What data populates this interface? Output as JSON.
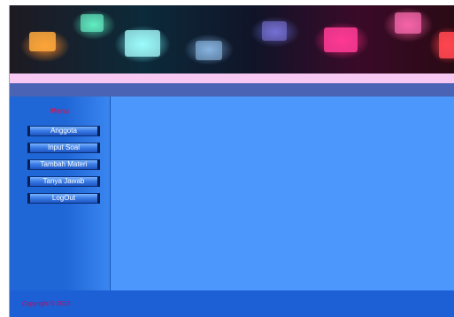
{
  "colors": {
    "banner_bg": "#1e1a22",
    "pink_bar": "#f7c8f2",
    "nav_bar": "#4a63b5",
    "sidebar": "#1f66d6",
    "content": "#4b97fb",
    "footer": "#1d5fd4",
    "menu_title": "#e3124a",
    "copyright": "#b40f6a"
  },
  "sidebar": {
    "title": "Menu",
    "items": [
      {
        "label": "Anggota"
      },
      {
        "label": "Input Soal"
      },
      {
        "label": "Tambah Materi"
      },
      {
        "label": "Tanya Jawab"
      },
      {
        "label": "LogOut"
      }
    ]
  },
  "footer": {
    "copyright": "Copyright © 2013"
  }
}
